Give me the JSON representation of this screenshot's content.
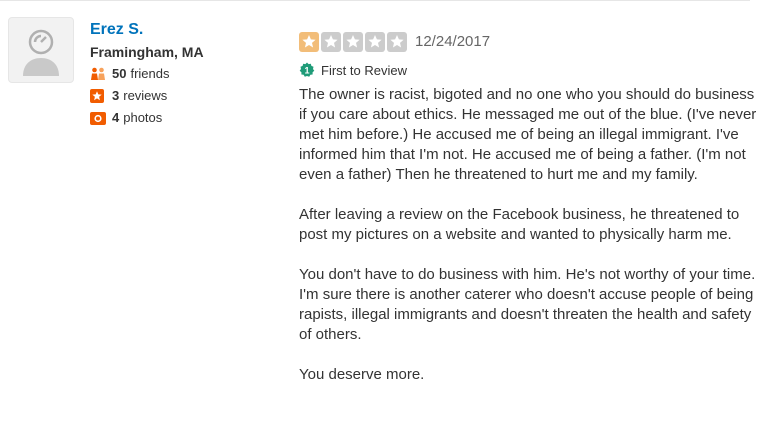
{
  "user": {
    "name": "Erez S.",
    "location": "Framingham, MA",
    "friends_count": "50",
    "friends_label": "friends",
    "reviews_count": "3",
    "reviews_label": "reviews",
    "photos_count": "4",
    "photos_label": "photos"
  },
  "review": {
    "rating": 1,
    "max_rating": 5,
    "date": "12/24/2017",
    "badge_label": "First to Review",
    "paragraphs": [
      "The owner is racist, bigoted and no one who you should do business if you care about ethics. He messaged me out of the blue. (I've never met him before.) He accused me of being an illegal immigrant. I've informed him that I'm not. He accused me of being a father. (I'm not even a father) Then he threatened to hurt me and my family.",
      "After leaving a review on the Facebook business, he threatened to post my pictures on a website and wanted to physically harm me.",
      "You don't have to do business with him. He's not worthy of your time. I'm sure there is another caterer who doesn't accuse people of being rapists, illegal immigrants and doesn't threaten the health and safety of others.",
      "You deserve more."
    ]
  },
  "colors": {
    "name_link": "#0073bb",
    "star_filled": "#f2bd79",
    "star_empty": "#cccccc",
    "friends_icon": "#f15c00",
    "reviews_icon": "#f15c00",
    "photos_icon": "#f15c00",
    "badge": "#1f9b78"
  }
}
